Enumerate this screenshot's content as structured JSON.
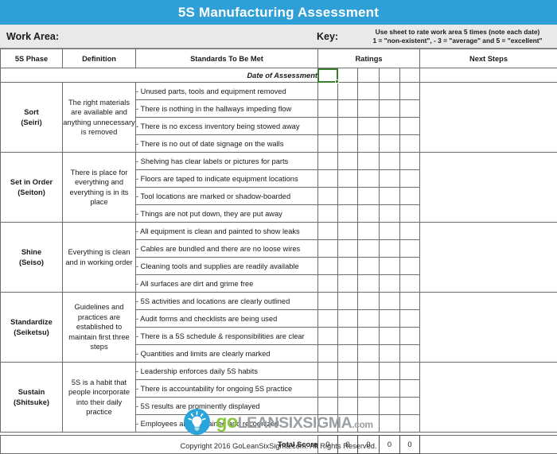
{
  "title": "5S Manufacturing Assessment",
  "work_area": {
    "label": "Work Area:",
    "value": ""
  },
  "key": {
    "label": "Key:",
    "line1": "Use sheet to rate work area 5 times (note each date)",
    "line2": "1 = \"non-existent\", - 3 = \"average\" and 5 = \"excellent\""
  },
  "columns": {
    "phase": "5S Phase",
    "definition": "Definition",
    "standards": "Standards To Be Met",
    "ratings": "Ratings",
    "next_steps": "Next Steps"
  },
  "date_row": {
    "label": "Date of Assessment",
    "values": [
      "",
      "",
      "",
      "",
      ""
    ]
  },
  "sections": [
    {
      "phase_line1": "Sort",
      "phase_line2": "(Seiri)",
      "definition": "The right materials are available and anything unnecessary is removed",
      "standards": [
        "- Unused parts, tools and equipment removed",
        "- There is nothing in the hallways impeding flow",
        "- There is no excess inventory being stowed away",
        "- There is no out of date signage on the walls"
      ],
      "ratings": [
        [
          "",
          "",
          "",
          "",
          ""
        ],
        [
          "",
          "",
          "",
          "",
          ""
        ],
        [
          "",
          "",
          "",
          "",
          ""
        ],
        [
          "",
          "",
          "",
          "",
          ""
        ]
      ],
      "next_steps": ""
    },
    {
      "phase_line1": "Set in Order",
      "phase_line2": "(Seiton)",
      "definition": "There is place for everything and everything is in its place",
      "standards": [
        "- Shelving has clear labels or pictures for parts",
        "- Floors are taped to indicate equipment locations",
        "- Tool locations are marked or shadow-boarded",
        "- Things are not put down, they are put away"
      ],
      "ratings": [
        [
          "",
          "",
          "",
          "",
          ""
        ],
        [
          "",
          "",
          "",
          "",
          ""
        ],
        [
          "",
          "",
          "",
          "",
          ""
        ],
        [
          "",
          "",
          "",
          "",
          ""
        ]
      ],
      "next_steps": ""
    },
    {
      "phase_line1": "Shine",
      "phase_line2": "(Seiso)",
      "definition": "Everything is clean and in working order",
      "standards": [
        "- All equipment is clean and painted to show leaks",
        "- Cables are bundled and there are no loose wires",
        "- Cleaning tools and supplies are readily available",
        "- All surfaces are dirt and grime free"
      ],
      "ratings": [
        [
          "",
          "",
          "",
          "",
          ""
        ],
        [
          "",
          "",
          "",
          "",
          ""
        ],
        [
          "",
          "",
          "",
          "",
          ""
        ],
        [
          "",
          "",
          "",
          "",
          ""
        ]
      ],
      "next_steps": ""
    },
    {
      "phase_line1": "Standardize",
      "phase_line2": "(Seiketsu)",
      "definition": "Guidelines and practices are established to maintain first three steps",
      "standards": [
        "- 5S activities and locations are clearly outlined",
        "- Audit forms and checklists are being used",
        "- There is a 5S schedule & responsibilities are clear",
        "- Quantities and limits are clearly marked"
      ],
      "ratings": [
        [
          "",
          "",
          "",
          "",
          ""
        ],
        [
          "",
          "",
          "",
          "",
          ""
        ],
        [
          "",
          "",
          "",
          "",
          ""
        ],
        [
          "",
          "",
          "",
          "",
          ""
        ]
      ],
      "next_steps": ""
    },
    {
      "phase_line1": "Sustain",
      "phase_line2": "(Shitsuke)",
      "definition": "5S is a habit that people incorporate into their daily practice",
      "standards": [
        "- Leadership enforces daily 5S habits",
        "- There is accountability for ongoing 5S practice",
        "- 5S results are prominently displayed",
        "- Employees are 5S-trained and recognized"
      ],
      "ratings": [
        [
          "",
          "",
          "",
          "",
          ""
        ],
        [
          "",
          "",
          "",
          "",
          ""
        ],
        [
          "",
          "",
          "",
          "",
          ""
        ],
        [
          "",
          "",
          "",
          "",
          ""
        ]
      ],
      "next_steps": ""
    }
  ],
  "total_score": {
    "label": "Total Score",
    "values": [
      "0",
      "0",
      "0",
      "0",
      "0"
    ]
  },
  "footer": {
    "logo_go": "go",
    "logo_lean": "LEANSIXSIGMA",
    "logo_com": ".com",
    "copyright": "Copyright 2016 GoLeanSixSigma.com. All Rights Reserved."
  },
  "colors": {
    "title_blue": "#2fa0d7",
    "header_green": "#7cb04f",
    "workarea_gray": "#e9e9e9",
    "logo_blue": "#2ba4dc",
    "logo_green": "#8cc63f",
    "logo_gray": "#9aa0a4",
    "selection_green": "#3a7d2c"
  }
}
